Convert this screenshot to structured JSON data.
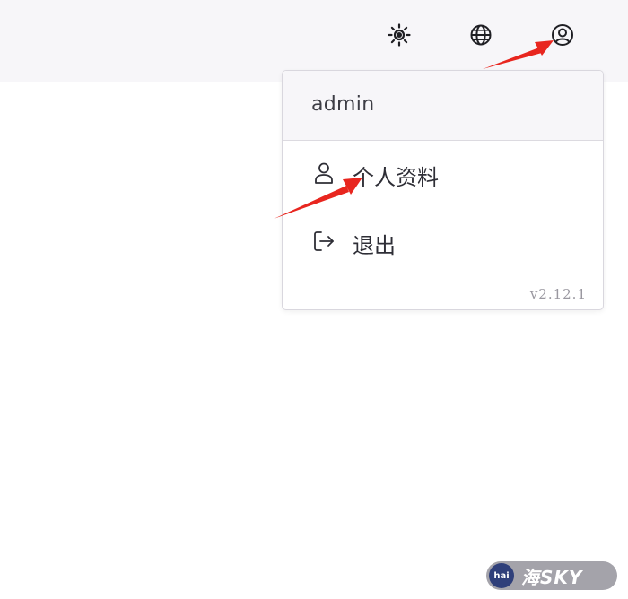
{
  "header": {
    "icons": [
      "sun-icon",
      "globe-icon",
      "user-circle-icon"
    ]
  },
  "user_menu": {
    "username": "admin",
    "items": [
      {
        "label": "个人资料",
        "icon": "user-icon"
      },
      {
        "label": "退出",
        "icon": "logout-icon"
      }
    ],
    "version": "v2.12.1"
  },
  "annotations": {
    "arrow_color": "#e8261f"
  },
  "watermark": {
    "logo_text": "hai",
    "text": "海SKY"
  }
}
